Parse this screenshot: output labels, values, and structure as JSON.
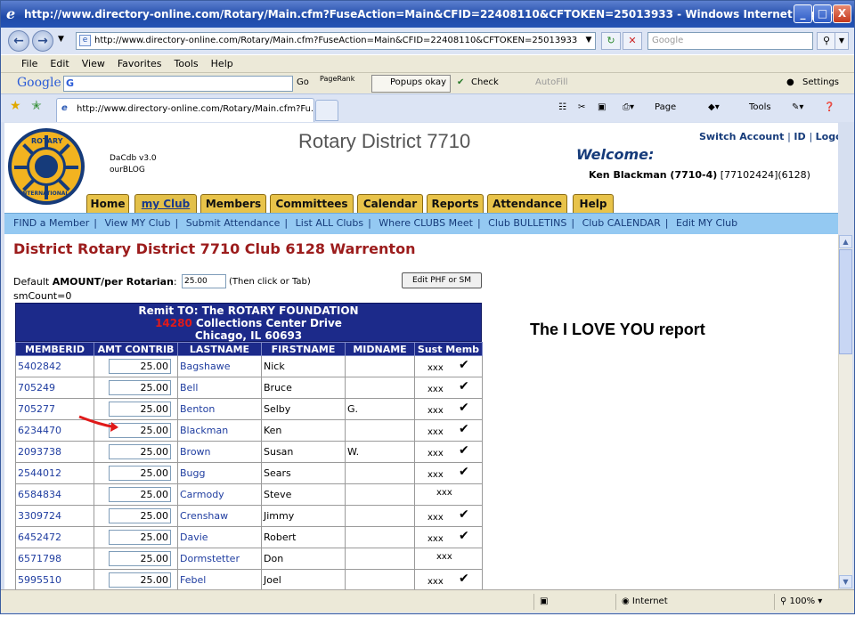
{
  "window": {
    "title": "http://www.directory-online.com/Rotary/Main.cfm?FuseAction=Main&CFID=22408110&CFTOKEN=25013933 - Windows Internet Explorer",
    "min_label": "_",
    "max_label": "□",
    "close_label": "X"
  },
  "addressbar": {
    "url": "http://www.directory-online.com/Rotary/Main.cfm?FuseAction=Main&CFID=22408110&CFTOKEN=25013933",
    "search_placeholder": "Google"
  },
  "menu": [
    "File",
    "Edit",
    "View",
    "Favorites",
    "Tools",
    "Help"
  ],
  "google_toolbar": {
    "logo": "Google",
    "go": "Go",
    "pagerank": "PageRank",
    "popups": "Popups okay",
    "check": "Check",
    "autofill": "AutoFill",
    "settings": "Settings"
  },
  "browser_tab": {
    "label": "http://www.directory-online.com/Rotary/Main.cfm?Fu...",
    "page": "Page",
    "tools": "Tools"
  },
  "header": {
    "dacdb": "DaCdb v3.0",
    "ourblog": "ourBLOG",
    "district": "Rotary District 7710",
    "switch_account": "Switch Account",
    "id": "ID",
    "logout": "Logout",
    "welcome": "Welcome:",
    "user_name": "Ken Blackman (7710-4)",
    "user_ids": " [77102424](6128)",
    "logo_top": "ROTARY",
    "logo_bottom": "INTERNATIONAL"
  },
  "main_tabs": [
    "Home",
    "my Club",
    "Members",
    "Committees",
    "Calendar",
    "Reports",
    "Attendance",
    "Help"
  ],
  "sub_nav": [
    "FIND a Member",
    "View MY Club",
    "Submit Attendance",
    "List ALL Clubs",
    "Where CLUBS Meet",
    "Club BULLETINS",
    "Club CALENDAR",
    "Edit MY Club"
  ],
  "page": {
    "title": "District Rotary District 7710 Club 6128 Warrenton",
    "default_prefix": "Default ",
    "default_bold": "AMOUNT/per Rotarian",
    "default_suffix": ":",
    "default_value": "25.00",
    "then_click": "(Then click or Tab)",
    "edit_phf": "Edit PHF or SM",
    "smcount": "smCount=0",
    "remit_line1": "Remit TO: The ROTARY FOUNDATION",
    "remit_num": "14280",
    "remit_line2": " Collections Center Drive",
    "remit_line3": "Chicago, IL 60693",
    "report_label": "The I LOVE YOU report"
  },
  "table": {
    "headers": [
      "MEMBERID",
      "AMT CONTRIB",
      "LASTNAME",
      "FIRSTNAME",
      "MIDNAME",
      "Sust Memb"
    ],
    "rows": [
      {
        "id": "5402842",
        "amt": "25.00",
        "last": "Bagshawe",
        "first": "Nick",
        "mid": "",
        "sust": "xxx",
        "check": true
      },
      {
        "id": "705249",
        "amt": "25.00",
        "last": "Bell",
        "first": "Bruce",
        "mid": "",
        "sust": "xxx",
        "check": true
      },
      {
        "id": "705277",
        "amt": "25.00",
        "last": "Benton",
        "first": "Selby",
        "mid": "G.",
        "sust": "xxx",
        "check": true
      },
      {
        "id": "6234470",
        "amt": "25.00",
        "last": "Blackman",
        "first": "Ken",
        "mid": "",
        "sust": "xxx",
        "check": true
      },
      {
        "id": "2093738",
        "amt": "25.00",
        "last": "Brown",
        "first": "Susan",
        "mid": "W.",
        "sust": "xxx",
        "check": true
      },
      {
        "id": "2544012",
        "amt": "25.00",
        "last": "Bugg",
        "first": "Sears",
        "mid": "",
        "sust": "xxx",
        "check": true
      },
      {
        "id": "6584834",
        "amt": "25.00",
        "last": "Carmody",
        "first": "Steve",
        "mid": "",
        "sust": "xxx",
        "check": false
      },
      {
        "id": "3309724",
        "amt": "25.00",
        "last": "Crenshaw",
        "first": "Jimmy",
        "mid": "",
        "sust": "xxx",
        "check": true
      },
      {
        "id": "6452472",
        "amt": "25.00",
        "last": "Davie",
        "first": "Robert",
        "mid": "",
        "sust": "xxx",
        "check": true
      },
      {
        "id": "6571798",
        "amt": "25.00",
        "last": "Dormstetter",
        "first": "Don",
        "mid": "",
        "sust": "xxx",
        "check": false
      },
      {
        "id": "5995510",
        "amt": "25.00",
        "last": "Febel",
        "first": "Joel",
        "mid": "",
        "sust": "xxx",
        "check": true
      }
    ]
  },
  "status": {
    "zone": "Internet",
    "zoom": "100%"
  },
  "colors": {
    "titlebar": "#2453b4",
    "tab_gold": "#e8c34a",
    "subnav": "#94c9f2",
    "table_header": "#1c2a8a",
    "title_red": "#9c1c1c",
    "arrow_red": "#e01a1a"
  }
}
